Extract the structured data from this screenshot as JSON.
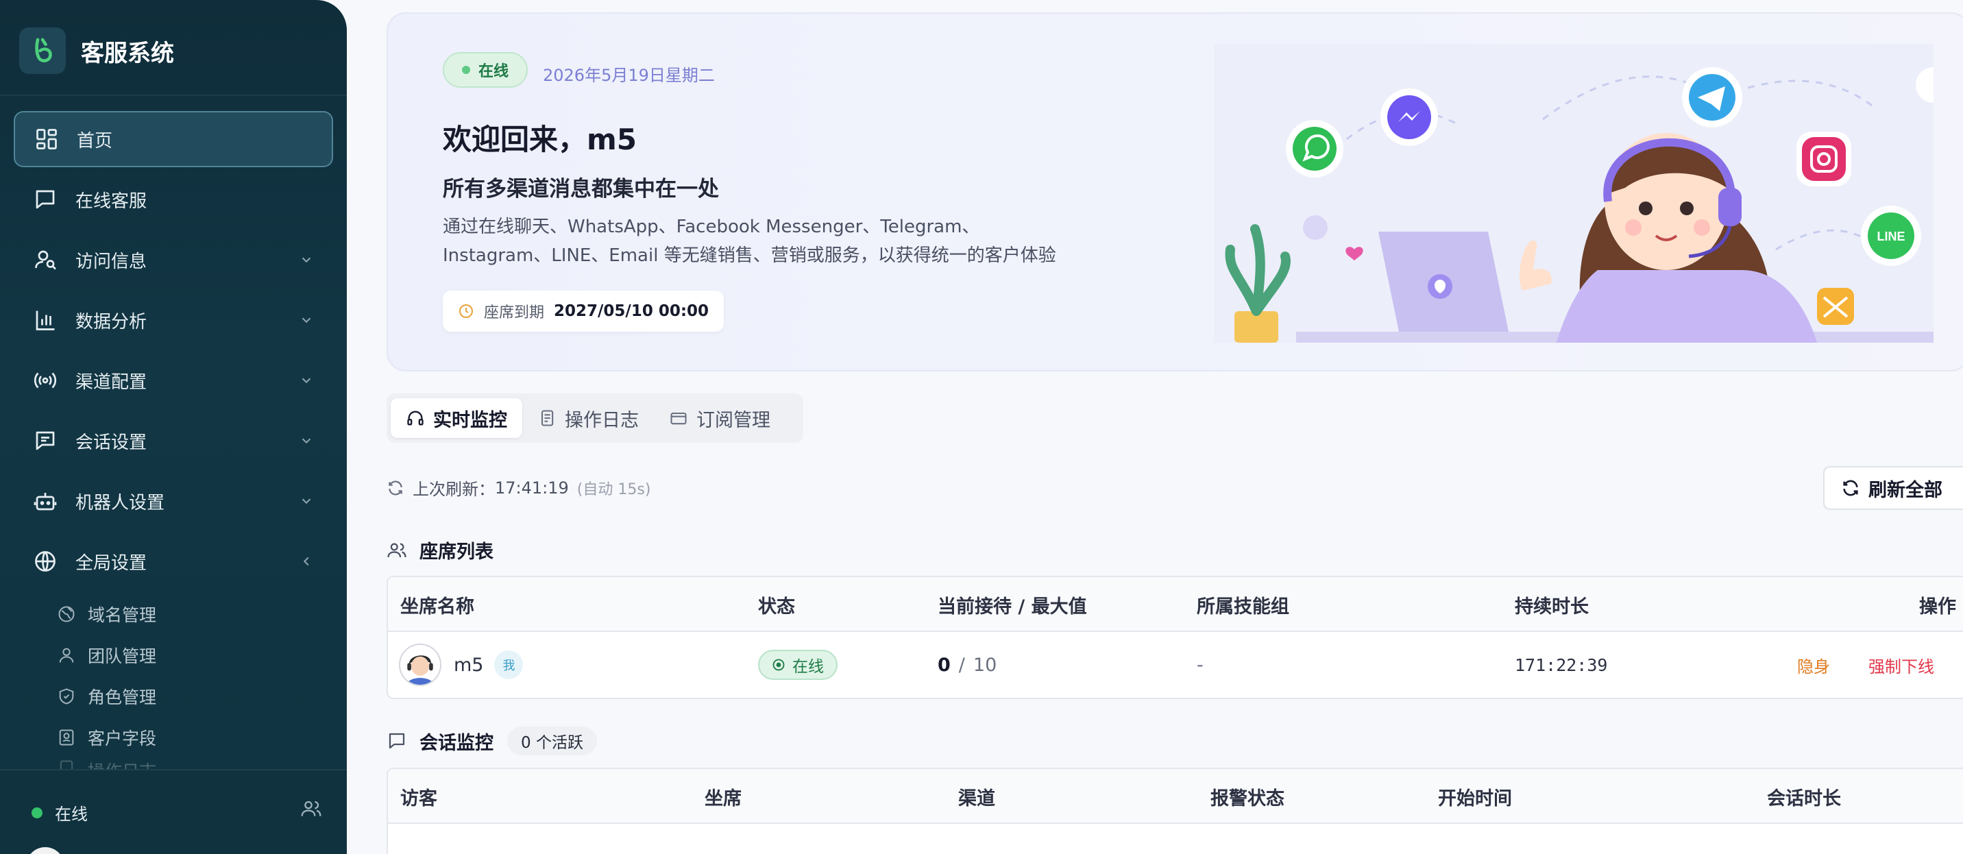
{
  "app": {
    "title": "客服系统",
    "accent": "#123644",
    "success": "#34c26a"
  },
  "sidebar": {
    "items": [
      {
        "label": "首页",
        "icon": "dashboard-icon",
        "active": true
      },
      {
        "label": "在线客服",
        "icon": "chat-bubble-icon"
      },
      {
        "label": "访问信息",
        "icon": "user-search-icon",
        "expandable": true
      },
      {
        "label": "数据分析",
        "icon": "bar-chart-icon",
        "expandable": true
      },
      {
        "label": "渠道配置",
        "icon": "broadcast-icon",
        "expandable": true
      },
      {
        "label": "会话设置",
        "icon": "message-lines-icon",
        "expandable": true
      },
      {
        "label": "机器人设置",
        "icon": "robot-icon",
        "expandable": true
      },
      {
        "label": "全局设置",
        "icon": "globe-icon",
        "expanded": true
      }
    ],
    "sub_items": [
      {
        "label": "域名管理",
        "icon": "domain-globe-icon"
      },
      {
        "label": "团队管理",
        "icon": "person-icon"
      },
      {
        "label": "角色管理",
        "icon": "shield-icon"
      },
      {
        "label": "客户字段",
        "icon": "id-card-icon"
      },
      {
        "label": "操作日志",
        "icon": "log-icon"
      }
    ],
    "footer_status": "在线"
  },
  "hero": {
    "status": "在线",
    "date": "2026年5月19日星期二",
    "welcome": "欢迎回来，m5",
    "subtitle": "所有多渠道消息都集中在一处",
    "desc_line1": "通过在线聊天、WhatsApp、Facebook Messenger、Telegram、",
    "desc_line2": "Instagram、LINE、Email 等无缝销售、营销或服务，以获得统一的客户体验",
    "seat_label": "座席到期",
    "seat_value": "2027/05/10 00:00",
    "line_badge": "LINE"
  },
  "tabs": [
    {
      "label": "实时监控",
      "active": true
    },
    {
      "label": "操作日志"
    },
    {
      "label": "订阅管理"
    }
  ],
  "refresh": {
    "label": "上次刷新：",
    "time": "17:41:19",
    "auto": "(自动 15s)",
    "button": "刷新全部"
  },
  "agents": {
    "title": "座席列表",
    "columns": [
      "坐席名称",
      "状态",
      "当前接待 / 最大值",
      "所属技能组",
      "持续时长",
      "操作"
    ],
    "rows": [
      {
        "name": "m5",
        "me": "我",
        "status": "在线",
        "current": "0",
        "sep": "/",
        "max": "10",
        "group": "-",
        "duration": "171:22:39",
        "action_hide": "隐身",
        "action_kick": "强制下线"
      }
    ]
  },
  "sessions": {
    "title": "会话监控",
    "active_count": "0 个活跃",
    "columns": [
      "访客",
      "坐席",
      "渠道",
      "报警状态",
      "开始时间",
      "会话时长"
    ]
  }
}
